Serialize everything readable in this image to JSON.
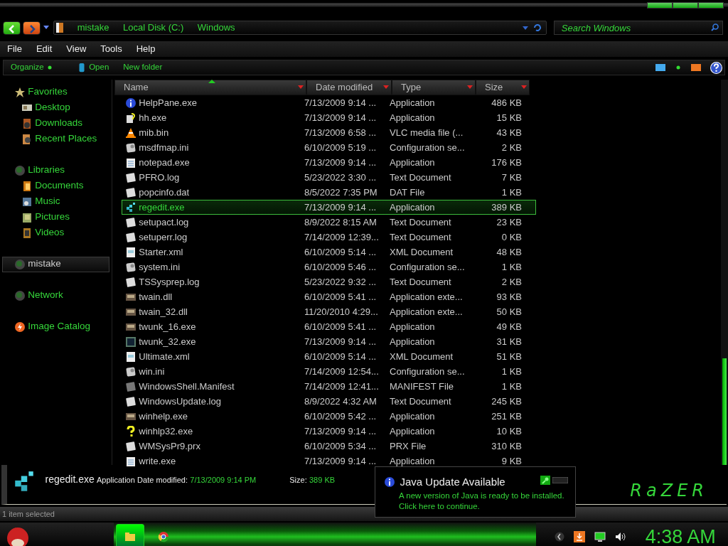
{
  "window": {
    "breadcrumbs": [
      "mistake",
      "Local Disk (C:)",
      "Windows"
    ],
    "search": {
      "placeholder": "Search Windows"
    }
  },
  "menu": [
    "File",
    "Edit",
    "View",
    "Tools",
    "Help"
  ],
  "commands": [
    {
      "label": "Organize",
      "kind": "dot"
    },
    {
      "label": "Open",
      "kind": "app"
    },
    {
      "label": "New folder",
      "kind": "none"
    }
  ],
  "sidebar": [
    {
      "label": "Favorites",
      "kind": "star",
      "selected": false,
      "children": [
        {
          "label": "Desktop",
          "kind": "desktop",
          "selected": false
        },
        {
          "label": "Downloads",
          "kind": "downloads",
          "selected": false
        },
        {
          "label": "Recent Places",
          "kind": "recent",
          "selected": false
        }
      ]
    },
    {
      "label": "Libraries",
      "kind": "orb",
      "selected": false,
      "children": [
        {
          "label": "Documents",
          "kind": "documents",
          "selected": false
        },
        {
          "label": "Music",
          "kind": "music",
          "selected": false
        },
        {
          "label": "Pictures",
          "kind": "pictures",
          "selected": false
        },
        {
          "label": "Videos",
          "kind": "videos",
          "selected": false
        }
      ]
    },
    {
      "label": "mistake",
      "kind": "orb",
      "selected": true
    },
    {
      "label": "Network",
      "kind": "orb",
      "selected": false
    },
    {
      "label": "Image Catalog",
      "kind": "bolt",
      "selected": false
    }
  ],
  "columns": [
    {
      "label": "Name"
    },
    {
      "label": "Date modified"
    },
    {
      "label": "Type"
    },
    {
      "label": "Size"
    }
  ],
  "rows": [
    {
      "name": "HelpPane.exe",
      "date": "7/13/2009 9:14 ...",
      "type": "Application",
      "size": "486 KB",
      "kind": "info",
      "selected": false
    },
    {
      "name": "hh.exe",
      "date": "7/13/2009 9:14 ...",
      "type": "Application",
      "size": "15 KB",
      "kind": "help",
      "selected": false
    },
    {
      "name": "mib.bin",
      "date": "7/13/2009 6:58 ...",
      "type": "VLC media file (...",
      "size": "43 KB",
      "kind": "cone",
      "selected": false
    },
    {
      "name": "msdfmap.ini",
      "date": "6/10/2009 5:19 ...",
      "type": "Configuration se...",
      "size": "2 KB",
      "kind": "config",
      "selected": false
    },
    {
      "name": "notepad.exe",
      "date": "7/13/2009 9:14 ...",
      "type": "Application",
      "size": "176 KB",
      "kind": "notepad",
      "selected": false
    },
    {
      "name": "PFRO.log",
      "date": "5/23/2022 3:30 ...",
      "type": "Text Document",
      "size": "7 KB",
      "kind": "doc",
      "selected": false
    },
    {
      "name": "popcinfo.dat",
      "date": "8/5/2022 7:35 PM",
      "type": "DAT File",
      "size": "1 KB",
      "kind": "doc",
      "selected": false
    },
    {
      "name": "regedit.exe",
      "date": "7/13/2009 9:14 ...",
      "type": "Application",
      "size": "389 KB",
      "kind": "cubes",
      "selected": true
    },
    {
      "name": "setupact.log",
      "date": "8/9/2022 8:15 AM",
      "type": "Text Document",
      "size": "23 KB",
      "kind": "doc",
      "selected": false
    },
    {
      "name": "setuperr.log",
      "date": "7/14/2009 12:39...",
      "type": "Text Document",
      "size": "0 KB",
      "kind": "doc",
      "selected": false
    },
    {
      "name": "Starter.xml",
      "date": "6/10/2009 5:14 ...",
      "type": "XML Document",
      "size": "48 KB",
      "kind": "xml",
      "selected": false
    },
    {
      "name": "system.ini",
      "date": "6/10/2009 5:46 ...",
      "type": "Configuration se...",
      "size": "1 KB",
      "kind": "config",
      "selected": false
    },
    {
      "name": "TSSysprep.log",
      "date": "5/23/2022 9:32 ...",
      "type": "Text Document",
      "size": "2 KB",
      "kind": "doc",
      "selected": false
    },
    {
      "name": "twain.dll",
      "date": "6/10/2009 5:41 ...",
      "type": "Application exte...",
      "size": "93 KB",
      "kind": "dll",
      "selected": false
    },
    {
      "name": "twain_32.dll",
      "date": "11/20/2010 4:29...",
      "type": "Application exte...",
      "size": "50 KB",
      "kind": "dll",
      "selected": false
    },
    {
      "name": "twunk_16.exe",
      "date": "6/10/2009 5:41 ...",
      "type": "Application",
      "size": "49 KB",
      "kind": "dll",
      "selected": false
    },
    {
      "name": "twunk_32.exe",
      "date": "7/13/2009 9:14 ...",
      "type": "Application",
      "size": "31 KB",
      "kind": "chip",
      "selected": false
    },
    {
      "name": "Ultimate.xml",
      "date": "6/10/2009 5:14 ...",
      "type": "XML Document",
      "size": "51 KB",
      "kind": "xml",
      "selected": false
    },
    {
      "name": "win.ini",
      "date": "7/14/2009 12:54...",
      "type": "Configuration se...",
      "size": "1 KB",
      "kind": "config",
      "selected": false
    },
    {
      "name": "WindowsShell.Manifest",
      "date": "7/14/2009 12:41...",
      "type": "MANIFEST File",
      "size": "1 KB",
      "kind": "grey",
      "selected": false
    },
    {
      "name": "WindowsUpdate.log",
      "date": "8/9/2022 4:32 AM",
      "type": "Text Document",
      "size": "245 KB",
      "kind": "doc",
      "selected": false
    },
    {
      "name": "winhelp.exe",
      "date": "6/10/2009 5:42 ...",
      "type": "Application",
      "size": "251 KB",
      "kind": "dll",
      "selected": false
    },
    {
      "name": "winhlp32.exe",
      "date": "7/13/2009 9:14 ...",
      "type": "Application",
      "size": "10 KB",
      "kind": "question",
      "selected": false
    },
    {
      "name": "WMSysPr9.prx",
      "date": "6/10/2009 5:34 ...",
      "type": "PRX File",
      "size": "310 KB",
      "kind": "doc",
      "selected": false
    },
    {
      "name": "write.exe",
      "date": "7/13/2009 9:14 ...",
      "type": "Application",
      "size": "9 KB",
      "kind": "notepad",
      "selected": false
    }
  ],
  "details": {
    "name": "regedit.exe",
    "type": "Application",
    "date_label": "Date modified:",
    "date": "7/13/2009 9:14 PM",
    "size_label": "Size:",
    "size": "389 KB",
    "logo": "RaZER"
  },
  "status_bar": "1 item selected",
  "notification": {
    "title": "Java Update Available",
    "lines": [
      "A new version of Java is ready to be installed.",
      "Click here to continue."
    ]
  },
  "taskbar": {
    "apps": [
      {
        "kind": "folder",
        "active": true
      },
      {
        "kind": "browser",
        "active": false
      }
    ],
    "clock": "4:38 AM"
  }
}
